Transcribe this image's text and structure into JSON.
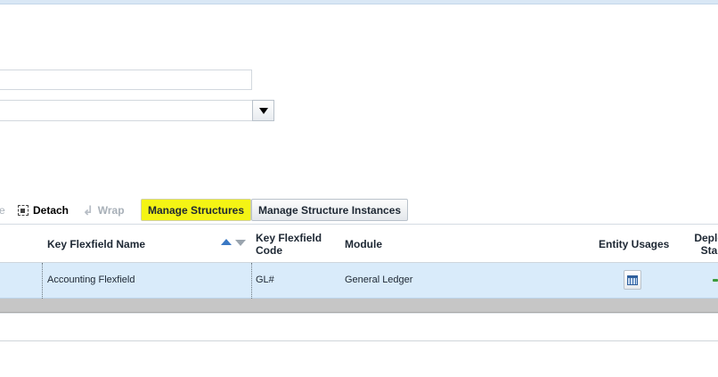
{
  "toolbar": {
    "cut_label_fragment": "e",
    "detach_label": "Detach",
    "wrap_label": "Wrap",
    "manage_structures_label": "Manage Structures",
    "manage_structure_instances_label": "Manage Structure Instances"
  },
  "table": {
    "columns": {
      "name": "Key Flexfield Name",
      "code_line1": "Key Flexfield",
      "code_line2": "Code",
      "module": "Module",
      "entity_usages": "Entity Usages",
      "deploy_line1": "Deplo",
      "deploy_line2": "Sta"
    },
    "rows": [
      {
        "name": "Accounting Flexfield",
        "code": "GL#",
        "module": "General Ledger"
      }
    ]
  },
  "colors": {
    "highlight": "#f4f414",
    "selected_row": "#d9ebfa",
    "sort_active": "#3a78c4"
  },
  "icons": [
    "dropdown-arrow-icon",
    "detach-icon",
    "wrap-icon",
    "sort-ascending-icon",
    "sort-descending-icon",
    "calendar-icon",
    "status-check-icon"
  ]
}
